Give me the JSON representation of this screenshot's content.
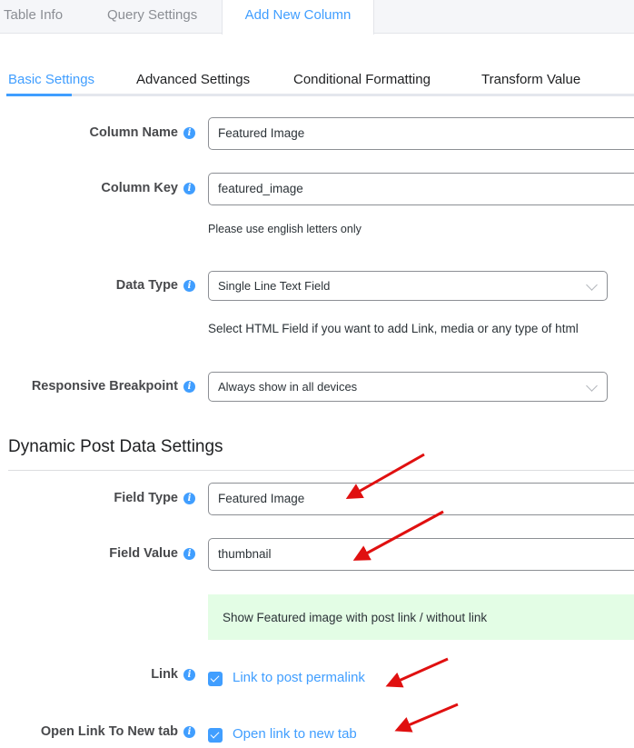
{
  "top_tabs": [
    {
      "label": "Table Info",
      "active": false
    },
    {
      "label": "Query Settings",
      "active": false
    },
    {
      "label": "Add New Column",
      "active": true
    }
  ],
  "sub_tabs": [
    {
      "label": "Basic Settings",
      "active": true
    },
    {
      "label": "Advanced Settings",
      "active": false
    },
    {
      "label": "Conditional Formatting",
      "active": false
    },
    {
      "label": "Transform Value",
      "active": false
    }
  ],
  "basic": {
    "column_name": {
      "label": "Column Name",
      "value": "Featured Image"
    },
    "column_key": {
      "label": "Column Key",
      "value": "featured_image",
      "help": "Please use english letters only"
    },
    "data_type": {
      "label": "Data Type",
      "value": "Single Line Text Field",
      "help": "Select HTML Field if you want to add Link, media or any type of html"
    },
    "responsive_breakpoint": {
      "label": "Responsive Breakpoint",
      "value": "Always show in all devices"
    }
  },
  "dynamic": {
    "title": "Dynamic Post Data Settings",
    "field_type": {
      "label": "Field Type",
      "value": "Featured Image"
    },
    "field_value": {
      "label": "Field Value",
      "value": "thumbnail"
    },
    "notice": "Show Featured image with post link / without link",
    "link": {
      "label": "Link",
      "checkbox_label": "Link to post permalink",
      "checked": true
    },
    "open_new_tab": {
      "label": "Open Link To New tab",
      "checkbox_label": "Open link to new tab",
      "checked": true
    }
  },
  "icons": {
    "info": "info-icon",
    "chevron": "chevron-down-icon",
    "check": "check-icon",
    "annotation": "red-arrow-annotation"
  },
  "colors": {
    "accent": "#409eff",
    "notice_bg": "#e3fde5",
    "annotation_red": "#e01010"
  }
}
